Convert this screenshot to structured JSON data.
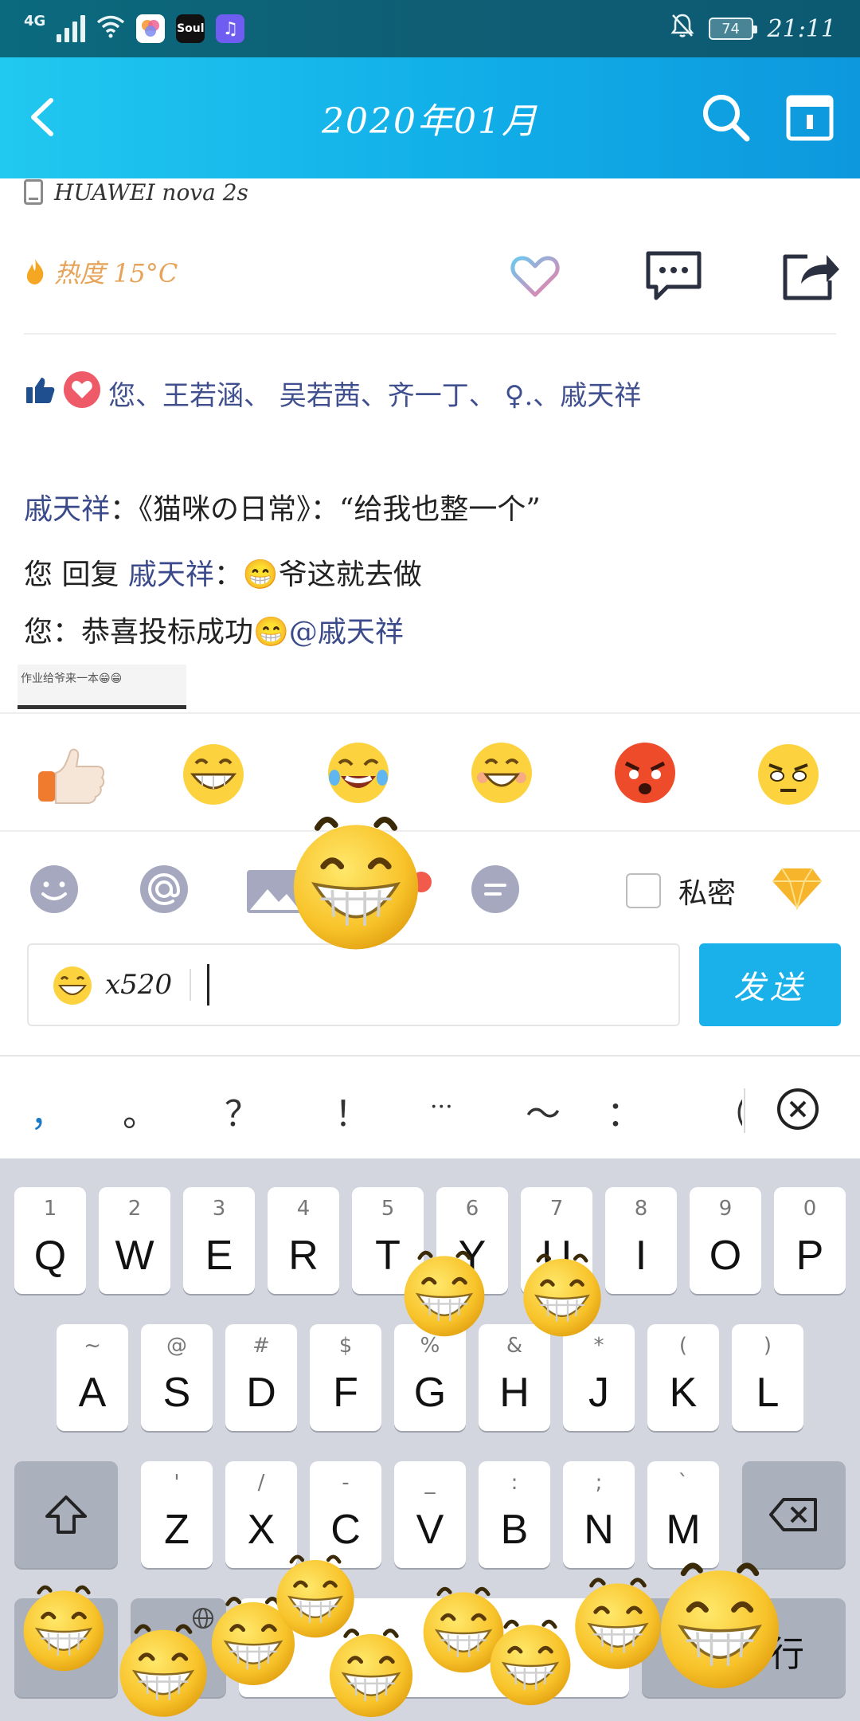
{
  "status_bar": {
    "network": "4G",
    "battery": "74",
    "time": "21:11",
    "app_icons": [
      {
        "name": "photos-app-icon",
        "bg": "#ffffff"
      },
      {
        "name": "soul-app-icon",
        "label": "Soul",
        "bg": "#111111"
      },
      {
        "name": "music-app-icon",
        "bg": "#6f5cf0"
      }
    ]
  },
  "header": {
    "title": "2020年01月"
  },
  "post": {
    "device": "HUAWEI nova 2s",
    "heat": "热度 15°C",
    "likes_text": "您、王若涵、 吴若茜、齐一丁、 ♀.、戚天祥",
    "comments": [
      {
        "author": "戚天祥",
        "text": "：《猫咪の日常》：“给我也整一个”"
      },
      {
        "prefix": "您 回复 ",
        "author": "戚天祥",
        "text": "：😁爷这就去做"
      },
      {
        "prefix": "您",
        "text": "：恭喜投标成功😁",
        "mention": "@戚天祥"
      }
    ],
    "thumbnail_text": "作业给爷来一本😁😁"
  },
  "emoji_strip": [
    "thumbs-up",
    "grin",
    "laugh-cry",
    "grin-blush",
    "angry",
    "annoyed"
  ],
  "input": {
    "emoji_count": "x520",
    "send_label": "发送"
  },
  "toolbar": {
    "private_label": "私密"
  },
  "punctuation": [
    "，",
    "。",
    "？",
    "！",
    "···",
    "～",
    "：",
    "（"
  ],
  "keyboard": {
    "row1": [
      {
        "num": "1",
        "letter": "Q"
      },
      {
        "num": "2",
        "letter": "W"
      },
      {
        "num": "3",
        "letter": "E"
      },
      {
        "num": "4",
        "letter": "R"
      },
      {
        "num": "5",
        "letter": "T"
      },
      {
        "num": "6",
        "letter": "Y"
      },
      {
        "num": "7",
        "letter": "U"
      },
      {
        "num": "8",
        "letter": "I"
      },
      {
        "num": "9",
        "letter": "O"
      },
      {
        "num": "0",
        "letter": "P"
      }
    ],
    "row2": [
      {
        "num": "~",
        "letter": "A"
      },
      {
        "num": "@",
        "letter": "S"
      },
      {
        "num": "#",
        "letter": "D"
      },
      {
        "num": "$",
        "letter": "F"
      },
      {
        "num": "%",
        "letter": "G"
      },
      {
        "num": "&",
        "letter": "H"
      },
      {
        "num": "*",
        "letter": "J"
      },
      {
        "num": "(",
        "letter": "K"
      },
      {
        "num": ")",
        "letter": "L"
      }
    ],
    "row3": [
      {
        "num": "'",
        "letter": "Z"
      },
      {
        "num": "/",
        "letter": "X"
      },
      {
        "num": "-",
        "letter": "C"
      },
      {
        "num": "_",
        "letter": "V"
      },
      {
        "num": ":",
        "letter": "B"
      },
      {
        "num": ";",
        "letter": "N"
      },
      {
        "num": "`",
        "letter": "M"
      }
    ],
    "enter_label": "行"
  },
  "colors": {
    "header_start": "#21c8ef",
    "header_end": "#0d98dd",
    "send_button": "#1ab1ea",
    "heat": "#e6a45b",
    "name_link": "#3b4a8a"
  }
}
